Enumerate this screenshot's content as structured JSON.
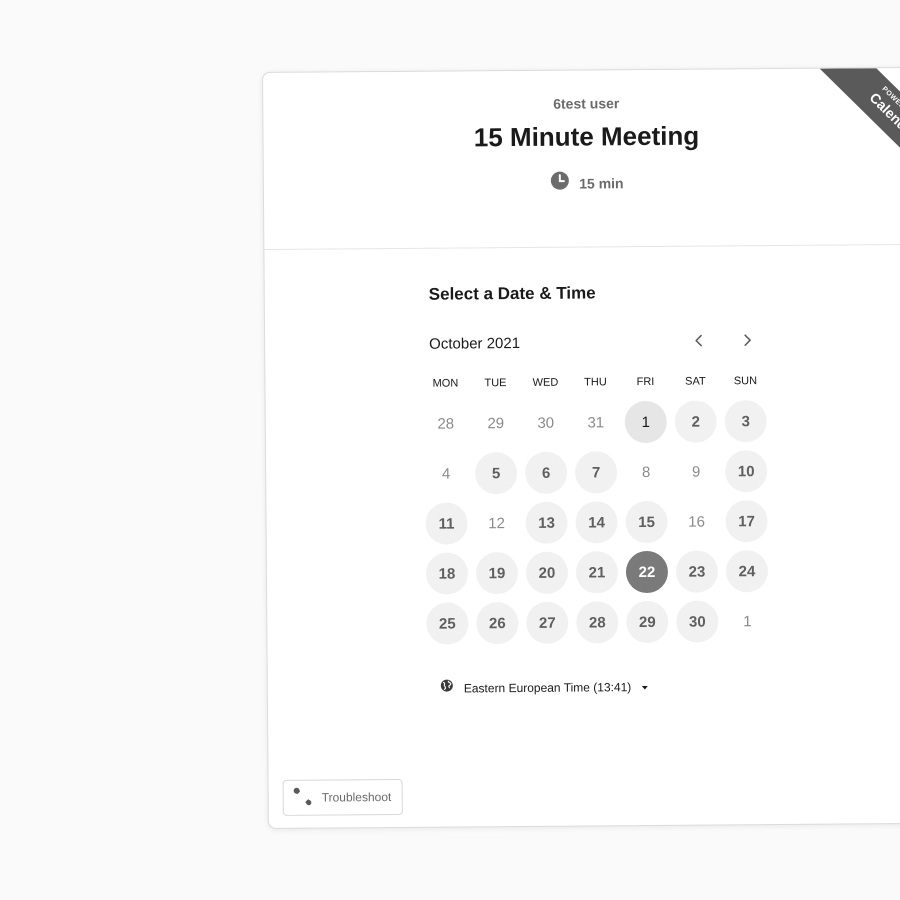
{
  "header": {
    "owner": "6test user",
    "event_title": "15 Minute Meeting",
    "duration": "15 min",
    "duration_icon": "clock-icon"
  },
  "ribbon": {
    "small": "POWERED BY",
    "big": "Calendly"
  },
  "calendar": {
    "section_title": "Select a Date & Time",
    "month": "October 2021",
    "weekdays": [
      "MON",
      "TUE",
      "WED",
      "THU",
      "FRI",
      "SAT",
      "SUN"
    ],
    "days": [
      {
        "label": "28",
        "state": "muted"
      },
      {
        "label": "29",
        "state": "muted"
      },
      {
        "label": "30",
        "state": "muted"
      },
      {
        "label": "31",
        "state": "muted"
      },
      {
        "label": "1",
        "state": "today"
      },
      {
        "label": "2",
        "state": "avail"
      },
      {
        "label": "3",
        "state": "avail"
      },
      {
        "label": "4",
        "state": "muted"
      },
      {
        "label": "5",
        "state": "avail"
      },
      {
        "label": "6",
        "state": "avail"
      },
      {
        "label": "7",
        "state": "avail"
      },
      {
        "label": "8",
        "state": "muted"
      },
      {
        "label": "9",
        "state": "muted"
      },
      {
        "label": "10",
        "state": "avail"
      },
      {
        "label": "11",
        "state": "avail"
      },
      {
        "label": "12",
        "state": "muted"
      },
      {
        "label": "13",
        "state": "avail"
      },
      {
        "label": "14",
        "state": "avail"
      },
      {
        "label": "15",
        "state": "avail"
      },
      {
        "label": "16",
        "state": "muted"
      },
      {
        "label": "17",
        "state": "avail"
      },
      {
        "label": "18",
        "state": "avail"
      },
      {
        "label": "19",
        "state": "avail"
      },
      {
        "label": "20",
        "state": "avail"
      },
      {
        "label": "21",
        "state": "avail"
      },
      {
        "label": "22",
        "state": "selected"
      },
      {
        "label": "23",
        "state": "avail"
      },
      {
        "label": "24",
        "state": "avail"
      },
      {
        "label": "25",
        "state": "avail"
      },
      {
        "label": "26",
        "state": "avail"
      },
      {
        "label": "27",
        "state": "avail"
      },
      {
        "label": "28",
        "state": "avail"
      },
      {
        "label": "29",
        "state": "avail"
      },
      {
        "label": "30",
        "state": "avail"
      },
      {
        "label": "1",
        "state": "muted"
      }
    ]
  },
  "timezone": {
    "label": "Eastern European Time (13:41)",
    "icon": "globe-icon"
  },
  "troubleshoot": {
    "label": "Troubleshoot",
    "icon": "wrench-icon"
  },
  "colors": {
    "selected_day": "#7a7a7a",
    "available_day": "#f1f1f1",
    "ribbon": "#5a5a5a"
  }
}
